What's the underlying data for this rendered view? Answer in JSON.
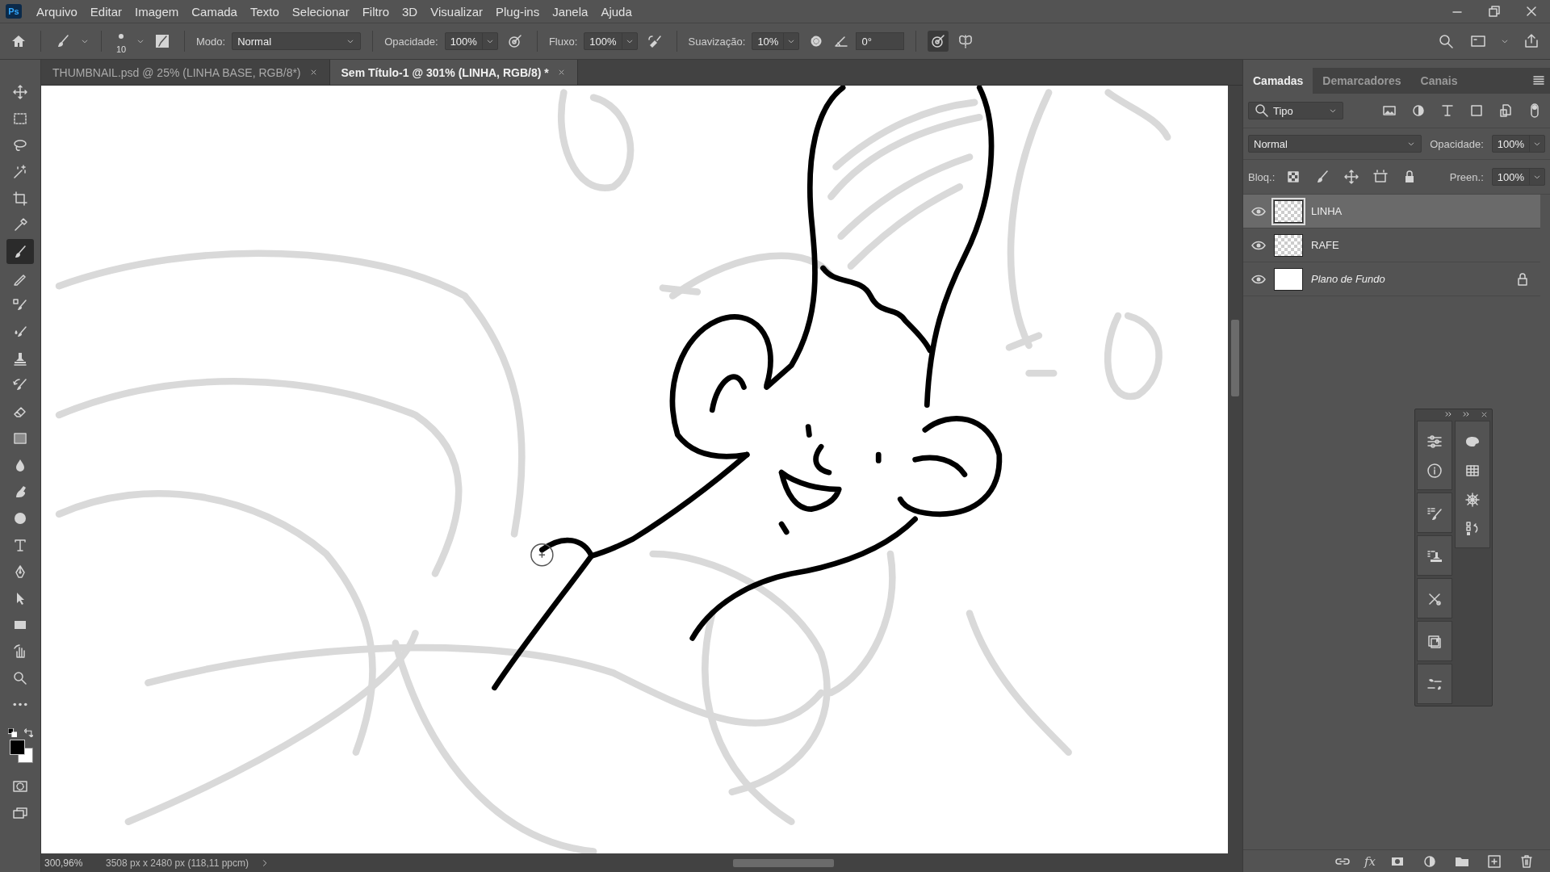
{
  "menu": {
    "app_badge": "Ps",
    "items": [
      "Arquivo",
      "Editar",
      "Imagem",
      "Camada",
      "Texto",
      "Selecionar",
      "Filtro",
      "3D",
      "Visualizar",
      "Plug-ins",
      "Janela",
      "Ajuda"
    ]
  },
  "options": {
    "brush_size": "10",
    "mode_label": "Modo:",
    "mode": "Normal",
    "opacity_label": "Opacidade:",
    "opacity": "100%",
    "flow_label": "Fluxo:",
    "flow": "100%",
    "smoothing_label": "Suavização:",
    "smoothing": "10%",
    "angle": "0°",
    "pressure_size_on": true
  },
  "tools": [
    {
      "selected": false
    },
    {
      "selected": false
    },
    {
      "selected": false
    },
    {
      "selected": false
    },
    {
      "selected": false
    },
    {
      "selected": false
    },
    {
      "selected": true
    },
    {
      "selected": false
    },
    {
      "selected": false
    },
    {
      "selected": false
    },
    {
      "selected": false
    },
    {
      "selected": false
    },
    {
      "selected": false
    },
    {
      "selected": false
    },
    {
      "selected": false
    },
    {
      "selected": false
    },
    {
      "selected": false
    },
    {
      "selected": false
    },
    {
      "selected": false
    },
    {
      "selected": false
    },
    {
      "selected": false
    },
    {
      "selected": false
    },
    {
      "selected": false
    },
    {
      "selected": false
    }
  ],
  "documents": {
    "tabs": [
      {
        "label": "THUMBNAIL.psd @ 25% (LINHA BASE, RGB/8*)",
        "selected": false
      },
      {
        "label": "Sem Título-1 @ 301% (LINHA, RGB/8) *",
        "selected": true
      }
    ]
  },
  "status_bar": {
    "zoom": "300,96%",
    "document_info": "3508 px x 2480 px (118,11 ppcm)"
  },
  "layers_panel": {
    "tabs": [
      {
        "label": "Camadas",
        "selected": true
      },
      {
        "label": "Demarcadores",
        "selected": false
      },
      {
        "label": "Canais",
        "selected": false
      }
    ],
    "filter": "Tipo",
    "blend_mode": "Normal",
    "opacity_label": "Opacidade:",
    "opacity": "100%",
    "lock_label": "Bloq.:",
    "fill_label": "Preen.:",
    "fill": "100%",
    "layers": [
      {
        "name": "LINHA",
        "kind": "transparent",
        "selected": true,
        "visible": true,
        "locked": false
      },
      {
        "name": "RAFE",
        "kind": "transparent",
        "selected": false,
        "visible": true,
        "locked": false
      },
      {
        "name": "Plano de Fundo",
        "kind": "background",
        "selected": false,
        "visible": true,
        "locked": true
      }
    ],
    "footer_fx": "fx"
  }
}
